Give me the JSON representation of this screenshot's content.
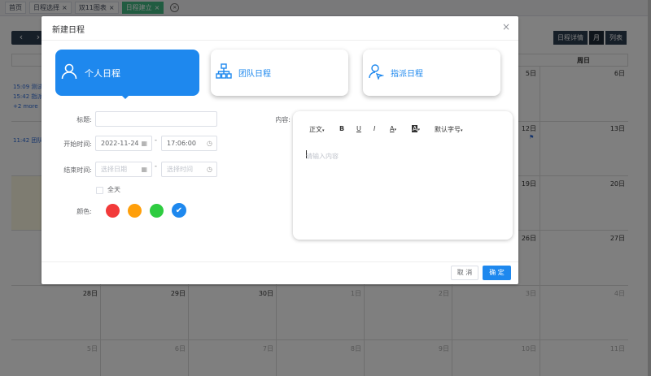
{
  "tabs": [
    {
      "label": "首页",
      "active": false
    },
    {
      "label": "日程选择",
      "active": false,
      "closable": true
    },
    {
      "label": "双11图表",
      "active": false,
      "closable": true
    },
    {
      "label": "日程建立",
      "active": true,
      "closable": true
    }
  ],
  "calendar": {
    "buttons": {
      "prev": "‹",
      "next": "›",
      "detail": "日程详情",
      "month": "月",
      "list": "列表"
    },
    "weekday_last": "周日",
    "days": {
      "r1c6": "5日",
      "r1c7": "6日",
      "r2c6": "12日",
      "r2c7": "13日",
      "r3c6": "19日",
      "r3c7": "20日",
      "r4c6": "26日",
      "r4c7": "27日",
      "r5c1": "28日",
      "r5c2": "29日",
      "r5c3": "30日",
      "r5c4": "1日",
      "r5c5": "2日",
      "r5c6": "3日",
      "r5c7": "4日",
      "r6c1": "5日",
      "r6c2": "6日",
      "r6c3": "7日",
      "r6c4": "8日",
      "r6c5": "9日",
      "r6c6": "10日",
      "r6c7": "11日"
    },
    "events": [
      {
        "text": "15:09 测试1"
      },
      {
        "text": "15:42 指派1"
      },
      {
        "text": "+2 more"
      },
      {
        "text": "11:42 团队1"
      }
    ]
  },
  "dialog": {
    "title": "新建日程",
    "close": "×",
    "types": [
      {
        "label": "个人日程",
        "icon": "user-icon",
        "active": true
      },
      {
        "label": "团队日程",
        "icon": "org-chart-icon",
        "active": false
      },
      {
        "label": "指派日程",
        "icon": "assign-user-icon",
        "active": false
      }
    ],
    "form": {
      "title_label": "标题:",
      "title_value": "",
      "start_label": "开始时间:",
      "start_date": "2022-11-24",
      "start_time": "17:06:00",
      "end_label": "结束时间:",
      "end_date_placeholder": "选择日期",
      "end_time_placeholder": "选择时间",
      "dash": "-",
      "allday_label": "全天",
      "color_label": "颜色:",
      "colors": [
        "#f23a3a",
        "#ff9f0a",
        "#2ecc40",
        "#1e88ee"
      ],
      "selected_color_index": 3,
      "content_label": "内容:"
    },
    "editor": {
      "toolbar": {
        "paragraph": "正文",
        "bold": "B",
        "underline": "U",
        "italic": "I",
        "font_color": "A",
        "bg_color": "A",
        "font_size": "默认字号"
      },
      "placeholder": "请输入内容"
    },
    "footer": {
      "cancel": "取 消",
      "ok": "确 定"
    }
  }
}
